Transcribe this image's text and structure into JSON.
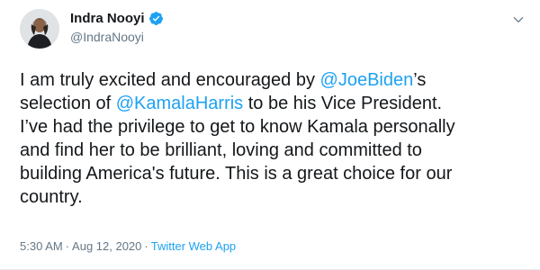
{
  "author": {
    "display_name": "Indra Nooyi",
    "handle": "@IndraNooyi",
    "verified_icon": "verified-badge-icon",
    "avatar_icon": "avatar-photo"
  },
  "menu": {
    "icon": "chevron-down-icon"
  },
  "tweet": {
    "line1": {
      "pre": "I am truly excited and encouraged by ",
      "mention": "@JoeBiden",
      "post": "’s"
    },
    "line2": {
      "pre": "selection of ",
      "mention": "@KamalaHarris",
      "post": " to be his Vice President."
    },
    "line3": "I’ve had the privilege to get to know Kamala personally",
    "line4": "and find her to be brilliant, loving and committed to",
    "line5": "building America's future. This is a great choice for our",
    "line6": "country."
  },
  "meta": {
    "time": "5:30 AM",
    "separator": "·",
    "date": "Aug 12, 2020",
    "source": "Twitter Web App"
  },
  "colors": {
    "link": "#1da1f2",
    "secondary": "#657786",
    "text": "#14171a"
  }
}
